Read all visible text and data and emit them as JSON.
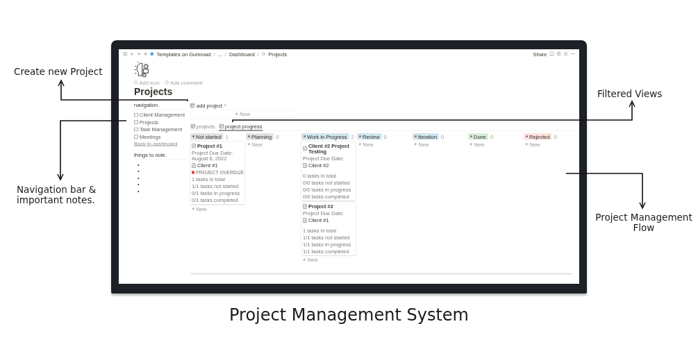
{
  "annotations": [
    {
      "text": "Create new Project"
    },
    {
      "text": "Navigation bar & important notes."
    },
    {
      "text": "Filtered Views"
    },
    {
      "text": "Project Management Flow"
    }
  ],
  "caption": "Project Management System",
  "screen": {
    "breadcrumb": [
      "Templates on Gumroad",
      "...",
      "Dashboard",
      "Projects"
    ],
    "separator": "/",
    "share": "Share",
    "page_actions": [
      "Add icon",
      "Add comment"
    ],
    "title": "Projects",
    "sidebar": {
      "heading": "navigation.",
      "links": [
        "Client Management",
        "Projects",
        "Task Management",
        "Meetings"
      ],
      "back_link": "Back to dashboard",
      "notes_heading": "things to note.",
      "bullets": [
        "•",
        "•",
        "•",
        "•",
        "•"
      ]
    },
    "database": {
      "name": "add project",
      "new": "New"
    },
    "views": [
      {
        "label": "projects",
        "selected": false
      },
      {
        "label": "project progress",
        "selected": true
      }
    ],
    "board": {
      "columns": [
        {
          "name": "Not started",
          "count": "1",
          "color": "#e3e2e0",
          "new": "New",
          "cards": [
            {
              "title": "Project #1",
              "due": "Project Due Date: August 6, 2022",
              "client": "Client #1",
              "flag": "PROJECT OVERDUE",
              "stats": [
                "1 tasks in total",
                "1/1 tasks not started",
                "0/1 tasks in progress",
                "0/1 tasks completed"
              ]
            }
          ]
        },
        {
          "name": "Planning",
          "count": "0",
          "color": "#e3e2e0",
          "new": "New"
        },
        {
          "name": "Work in Progress",
          "count": "2",
          "color": "#d3e5ef",
          "new": "New",
          "cards": [
            {
              "title": "Client #2 Project Testing",
              "due": "Project Due Date:",
              "client": "Client #2",
              "stats": [
                "0 tasks in total",
                "0/0 tasks not started",
                "0/0 tasks in progress",
                "0/0 tasks completed"
              ]
            },
            {
              "title": "Project #2",
              "due": "Project Due Date:",
              "client": "Client #1",
              "stats": [
                "1 tasks in total",
                "1/1 tasks not started",
                "1/1 tasks in progress",
                "1/1 tasks completed"
              ]
            }
          ]
        },
        {
          "name": "Review",
          "count": "0",
          "color": "#d3e5ef",
          "new": "New"
        },
        {
          "name": "Iteration",
          "count": "0",
          "color": "#d3e5ef",
          "new": "New"
        },
        {
          "name": "Done",
          "count": "0",
          "color": "#dbeddb",
          "new": "New"
        },
        {
          "name": "Rejected",
          "count": "0",
          "color": "#ffe2dd",
          "new": "New"
        }
      ]
    }
  }
}
